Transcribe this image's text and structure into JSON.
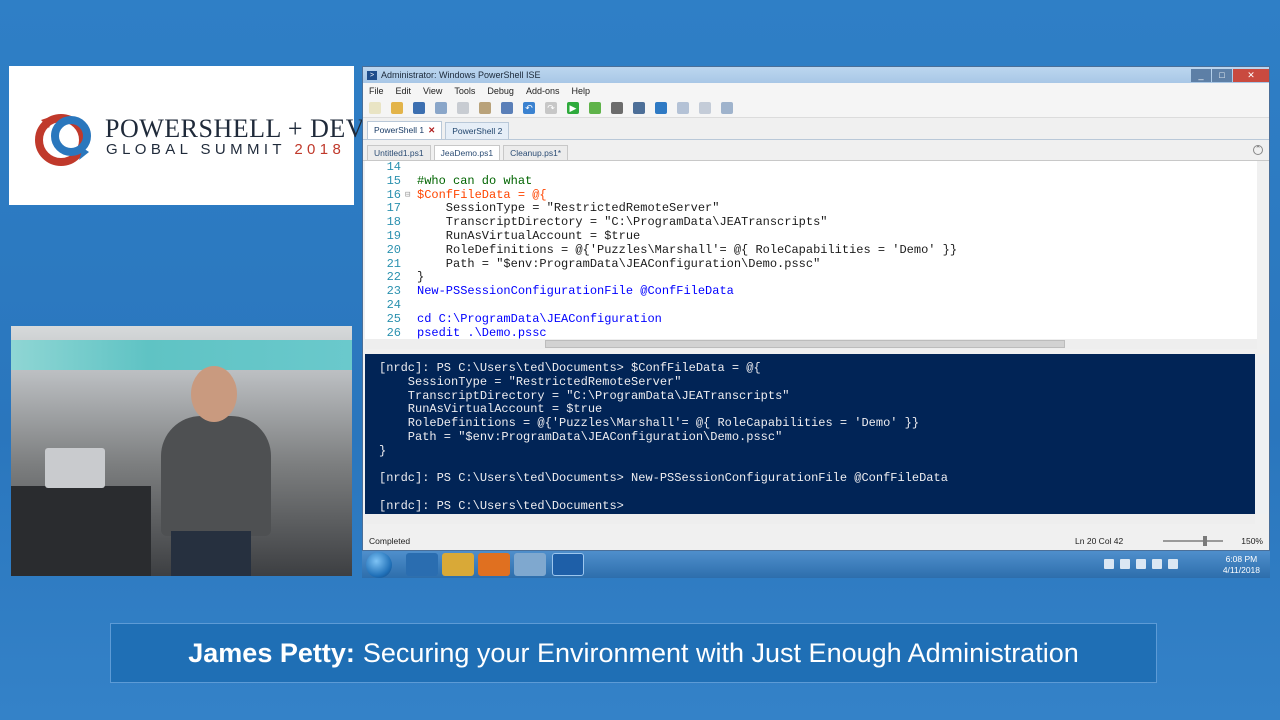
{
  "logo": {
    "line1": "POWERSHELL + DEVOPS",
    "line2_prefix": "GLOBAL SUMMIT",
    "line2_year": "2018"
  },
  "window": {
    "title": "Administrator: Windows PowerShell ISE",
    "controls": {
      "minimize": "_",
      "maximize": "□",
      "close": "✕"
    }
  },
  "menu": [
    "File",
    "Edit",
    "View",
    "Tools",
    "Debug",
    "Add-ons",
    "Help"
  ],
  "toolbar_icons": [
    "new-icon",
    "open-icon",
    "save-icon",
    "cut-icon",
    "copy-icon",
    "paste-icon",
    "clear-icon",
    "undo-icon",
    "redo-icon",
    "run-icon",
    "run-selection-icon",
    "stop-icon",
    "remote-icon",
    "start-powershell-icon",
    "layout-icon",
    "pane-icon",
    "zoom-icon"
  ],
  "runspace_tabs": [
    {
      "label": "PowerShell 1",
      "active": true
    },
    {
      "label": "PowerShell 2",
      "active": false
    }
  ],
  "file_tabs": [
    {
      "label": "Untitled1.ps1",
      "active": false
    },
    {
      "label": "JeaDemo.ps1",
      "active": true
    },
    {
      "label": "Cleanup.ps1*",
      "active": false
    }
  ],
  "script_lines": [
    {
      "n": "14",
      "fold": "",
      "text": ""
    },
    {
      "n": "15",
      "fold": "",
      "text": "#who can do what"
    },
    {
      "n": "16",
      "fold": "⊟",
      "text": "$ConfFileData = @{"
    },
    {
      "n": "17",
      "fold": "",
      "text": "    SessionType = \"RestrictedRemoteServer\""
    },
    {
      "n": "18",
      "fold": "",
      "text": "    TranscriptDirectory = \"C:\\ProgramData\\JEATranscripts\""
    },
    {
      "n": "19",
      "fold": "",
      "text": "    RunAsVirtualAccount = $true"
    },
    {
      "n": "20",
      "fold": "",
      "text": "    RoleDefinitions = @{'Puzzles\\Marshall'= @{ RoleCapabilities = 'Demo' }}"
    },
    {
      "n": "21",
      "fold": "",
      "text": "    Path = \"$env:ProgramData\\JEAConfiguration\\Demo.pssc\""
    },
    {
      "n": "22",
      "fold": "",
      "text": "}"
    },
    {
      "n": "23",
      "fold": "",
      "text": "New-PSSessionConfigurationFile @ConfFileData"
    },
    {
      "n": "24",
      "fold": "",
      "text": ""
    },
    {
      "n": "25",
      "fold": "",
      "text": "cd C:\\ProgramData\\JEAConfiguration"
    },
    {
      "n": "26",
      "fold": "",
      "text": "psedit .\\Demo.pssc"
    }
  ],
  "console_lines": [
    "[nrdc]: PS C:\\Users\\ted\\Documents> $ConfFileData = @{",
    "    SessionType = \"RestrictedRemoteServer\"",
    "    TranscriptDirectory = \"C:\\ProgramData\\JEATranscripts\"",
    "    RunAsVirtualAccount = $true",
    "    RoleDefinitions = @{'Puzzles\\Marshall'= @{ RoleCapabilities = 'Demo' }}",
    "    Path = \"$env:ProgramData\\JEAConfiguration\\Demo.pssc\"",
    "}",
    "",
    "[nrdc]: PS C:\\Users\\ted\\Documents> New-PSSessionConfigurationFile @ConfFileData",
    "",
    "[nrdc]: PS C:\\Users\\ted\\Documents>"
  ],
  "status": {
    "text": "Completed",
    "position": "Ln 20  Col 42",
    "zoom": "150%"
  },
  "taskbar": {
    "time": "6:08 PM",
    "date": "4/11/2018",
    "apps": [
      "ie-icon",
      "explorer-icon",
      "media-player-icon",
      "notepad-icon",
      "powershell-ise-icon"
    ]
  },
  "lower_third": {
    "name": "James Petty:",
    "talk": "Securing your Environment with Just Enough Administration"
  },
  "colors": {
    "background": "#2a76bd",
    "console_bg": "#012456",
    "lower_third_bg": "#1f6fb5",
    "comment": "#006400",
    "variable": "#ff4500",
    "string": "#8b0000",
    "cmdlet": "#0000ff"
  }
}
